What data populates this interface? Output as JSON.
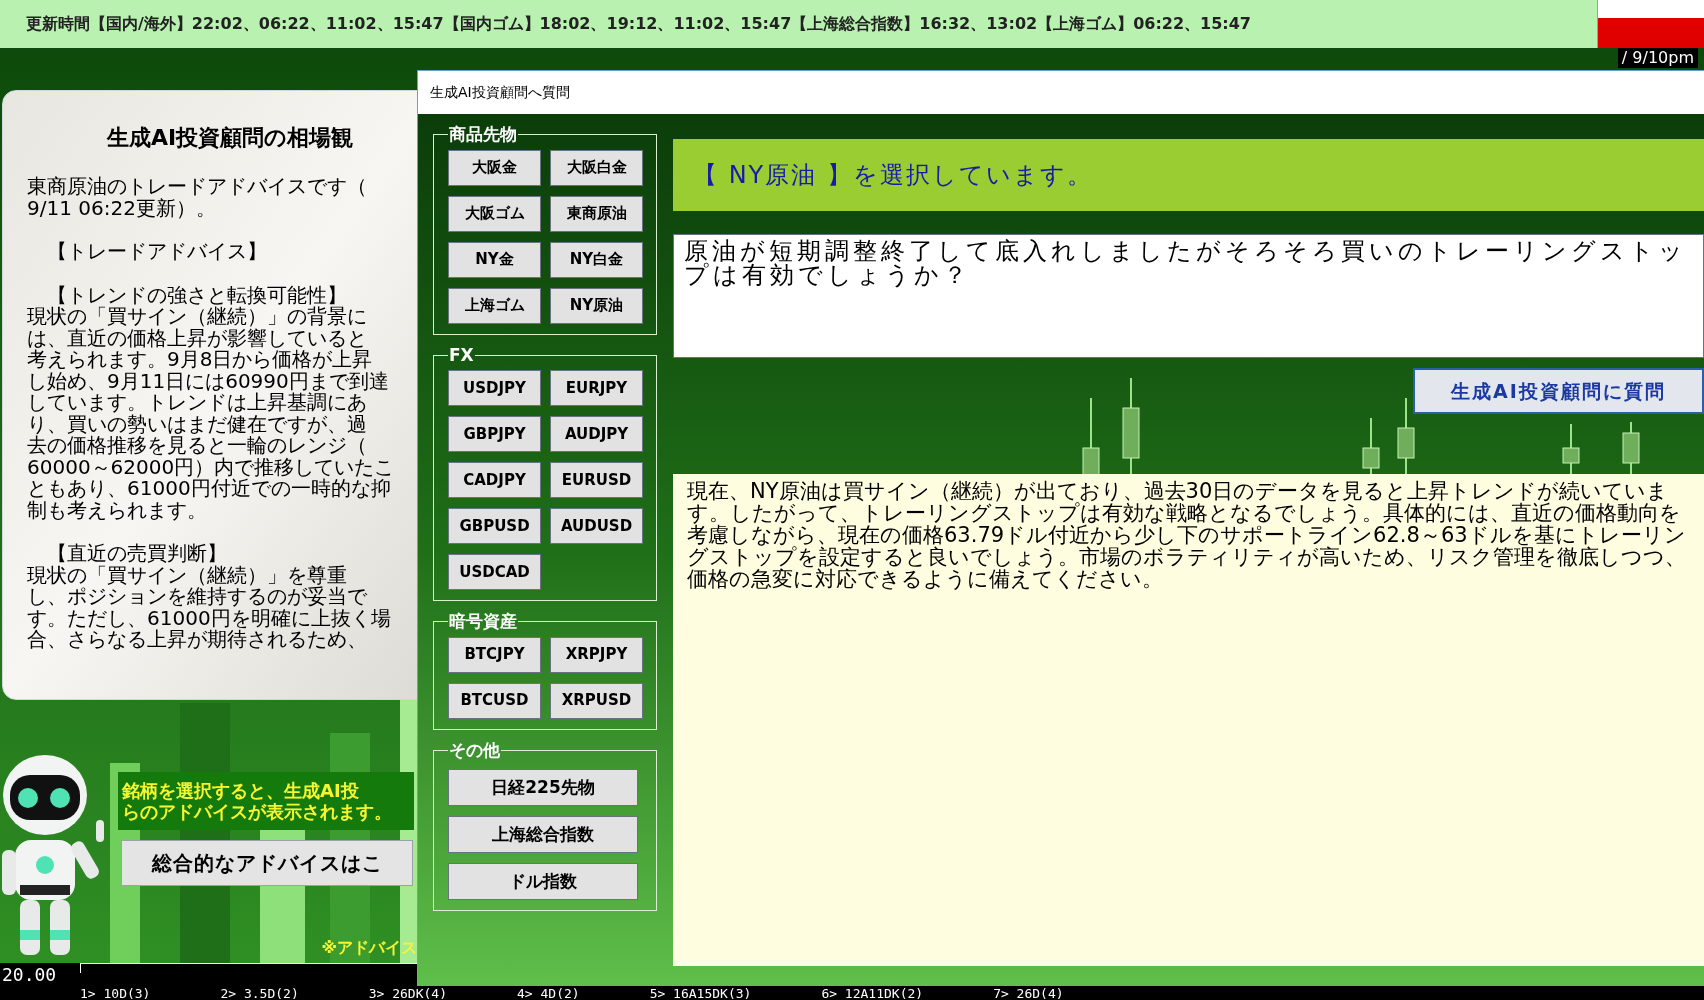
{
  "update_bar": {
    "text": "更新時間【国内/海外】22:02、06:22、11:02、15:47【国内ゴム】18:02、19:12、11:02、15:47【上海総合指数】16:32、13:02【上海ゴム】06:22、15:47"
  },
  "clock": "/ 9/10pm",
  "advice_panel": {
    "title": "生成AI投資顧問の相場観",
    "paragraphs": [
      {
        "lines": [
          "東商原油のトレードアドバイスです（",
          "9/11 06:22更新）。"
        ]
      },
      {
        "lines": [
          "　【トレードアドバイス】"
        ]
      },
      {
        "lines": [
          "　【トレンドの強さと転換可能性】",
          "現状の「買サイン（継続）」の背景に",
          "は、直近の価格上昇が影響していると",
          "考えられます。9月8日から価格が上昇",
          "し始め、9月11日には60990円まで到達",
          "しています。トレンドは上昇基調にあ",
          "り、買いの勢いはまだ健在ですが、過",
          "去の価格推移を見ると一輪のレンジ（",
          "60000～62000円）内で推移していたこ",
          "ともあり、61000円付近での一時的な抑",
          "制も考えられます。"
        ]
      },
      {
        "lines": [
          "　【直近の売買判断】",
          "現状の「買サイン（継続）」を尊重",
          "し、ポジションを維持するのが妥当で",
          "す。ただし、61000円を明確に上抜く場",
          "合、さらなる上昇が期待されるため、"
        ]
      }
    ]
  },
  "prompt_box": {
    "lines": [
      "銘柄を選択すると、生成AI投",
      "らのアドバイスが表示されます。"
    ]
  },
  "summary_button": "総合的なアドバイスはこ",
  "note": "※アドバイス",
  "axis": {
    "value": "20.00",
    "labels": [
      "1> 10D(3)",
      "2> 3.5D(2)",
      "3> 26DK(4)",
      "4> 4D(2)",
      "5> 16A15DK(3)",
      "6> 12A11DK(2)",
      "7> 26D(4)"
    ]
  },
  "dialog": {
    "title": "生成AI投資顧問へ質問",
    "groups": [
      {
        "legend": "商品先物",
        "kind": "pair",
        "buttons": [
          "大阪金",
          "大阪白金",
          "大阪ゴム",
          "東商原油",
          "NY金",
          "NY白金",
          "上海ゴム",
          "NY原油"
        ]
      },
      {
        "legend": "FX",
        "kind": "pair",
        "buttons": [
          "USDJPY",
          "EURJPY",
          "GBPJPY",
          "AUDJPY",
          "CADJPY",
          "EURUSD",
          "GBPUSD",
          "AUDUSD",
          "USDCAD"
        ]
      },
      {
        "legend": "暗号資産",
        "kind": "pair",
        "buttons": [
          "BTCJPY",
          "XRPJPY",
          "BTCUSD",
          "XRPUSD"
        ]
      },
      {
        "legend": "その他",
        "kind": "wide",
        "buttons": [
          "日経225先物",
          "上海総合指数",
          "ドル指数"
        ]
      }
    ],
    "selection_header": "【 NY原油 】を選択しています。",
    "question": "原油が短期調整終了して底入れしましたがそろそろ買いのトレーリングストップは有効でしょうか？",
    "ask_button": "生成AI投資顧問に質問",
    "answer": "現在、NY原油は買サイン（継続）が出ており、過去30日のデータを見ると上昇トレンドが続いています。したがって、トレーリングストップは有効な戦略となるでしょう。具体的には、直近の価格動向を考慮しながら、現在の価格63.79ドル付近から少し下のサポートライン62.8～63ドルを基にトレーリングストップを設定すると良いでしょう。市場のボラティリティが高いため、リスク管理を徹底しつつ、価格の急変に対応できるように備えてください。"
  }
}
